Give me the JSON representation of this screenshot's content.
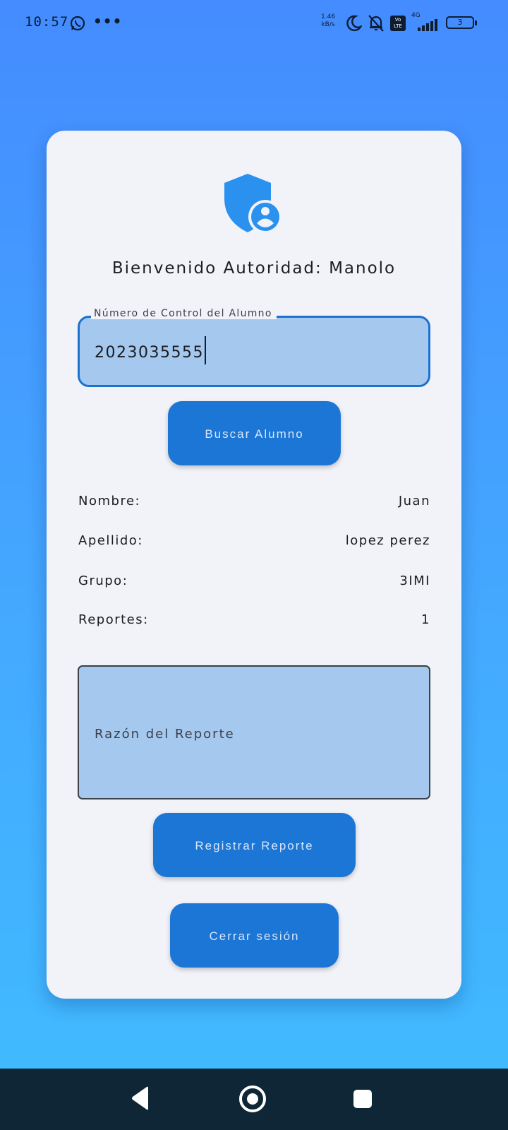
{
  "status_bar": {
    "time": "10:57",
    "more": "•••",
    "net_speed_value": "1.46",
    "net_speed_unit": "kB/s",
    "volte": "Vo LTE",
    "network": "4G",
    "battery": "3",
    "icons": [
      "whatsapp-icon",
      "moon-icon",
      "bell-off-icon",
      "volte-icon",
      "signal-icon",
      "battery-icon"
    ]
  },
  "header": {
    "icon": "shield-user-icon",
    "welcome": "Bienvenido Autoridad: Manolo"
  },
  "control_field": {
    "label": "Número de Control del Alumno",
    "value": "2023035555"
  },
  "search_button": "Buscar Alumno",
  "student": [
    {
      "label": "Nombre:",
      "value": "Juan"
    },
    {
      "label": "Apellido:",
      "value": "lopez perez"
    },
    {
      "label": "Grupo:",
      "value": "3IMI"
    },
    {
      "label": "Reportes:",
      "value": "1"
    }
  ],
  "reason_field": {
    "placeholder": "Razón del Reporte"
  },
  "register_button": "Registrar Reporte",
  "logout_button": "Cerrar sesión",
  "colors": {
    "background_top": "#448cff",
    "background_bottom": "#40bcff",
    "card": "#f2f3f9",
    "button": "#1c76d5",
    "field_fill": "#a5c8ee",
    "accent": "#1d72cd",
    "shield": "#2a91ee",
    "nav_bar": "#0e2635"
  }
}
